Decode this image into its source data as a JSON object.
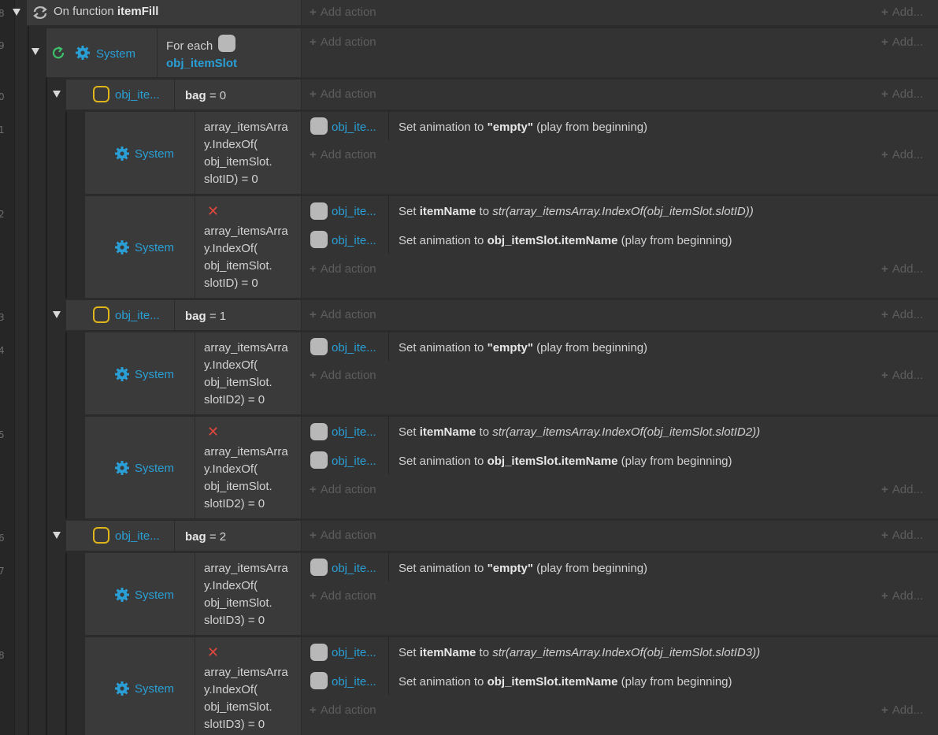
{
  "line_numbers": [
    "8",
    "9",
    "0",
    "1",
    "2",
    "3",
    "4",
    "5",
    "6",
    "7",
    "8"
  ],
  "root_event": {
    "prefix": "On function ",
    "name": "itemFill"
  },
  "add_action_label": "Add action",
  "add_right_label": "Add...",
  "for_each": {
    "system_label": "System",
    "text": "For each",
    "object": "obj_itemSlot"
  },
  "object_short": "obj_ite...",
  "system_label": "System",
  "bag_groups": [
    {
      "cond_var": "bag",
      "cond_rest": " = 0",
      "sub1": {
        "cond": "array_itemsArra\ny.IndexOf(\nobj_itemSlot.\nslotID) = 0",
        "action": {
          "pre": "Set animation to ",
          "val": "\"empty\"",
          "post": " (play from beginning)"
        }
      },
      "sub2": {
        "cond": "array_itemsArra\ny.IndexOf(\nobj_itemSlot.\nslotID) = 0",
        "a1": {
          "pre": "Set ",
          "var": "itemName",
          "mid": " to ",
          "expr": "str(array_itemsArray.IndexOf(obj_itemSlot.slotID))"
        },
        "a2": {
          "pre": "Set animation to ",
          "val": "obj_itemSlot.itemName",
          "post": " (play from beginning)"
        }
      }
    },
    {
      "cond_var": "bag",
      "cond_rest": " = 1",
      "sub1": {
        "cond": "array_itemsArra\ny.IndexOf(\nobj_itemSlot.\nslotID2) = 0",
        "action": {
          "pre": "Set animation to ",
          "val": "\"empty\"",
          "post": " (play from beginning)"
        }
      },
      "sub2": {
        "cond": "array_itemsArra\ny.IndexOf(\nobj_itemSlot.\nslotID2) = 0",
        "a1": {
          "pre": "Set ",
          "var": "itemName",
          "mid": " to ",
          "expr": "str(array_itemsArray.IndexOf(obj_itemSlot.slotID2))"
        },
        "a2": {
          "pre": "Set animation to ",
          "val": "obj_itemSlot.itemName",
          "post": " (play from beginning)"
        }
      }
    },
    {
      "cond_var": "bag",
      "cond_rest": " = 2",
      "sub1": {
        "cond": "array_itemsArra\ny.IndexOf(\nobj_itemSlot.\nslotID3) = 0",
        "action": {
          "pre": "Set animation to ",
          "val": "\"empty\"",
          "post": " (play from beginning)"
        }
      },
      "sub2": {
        "cond": "array_itemsArra\ny.IndexOf(\nobj_itemSlot.\nslotID3) = 0",
        "a1": {
          "pre": "Set ",
          "var": "itemName",
          "mid": " to ",
          "expr": "str(array_itemsArray.IndexOf(obj_itemSlot.slotID3))"
        },
        "a2": {
          "pre": "Set animation to ",
          "val": "obj_itemSlot.itemName",
          "post": " (play from beginning)"
        }
      }
    }
  ],
  "colors": {
    "accent": "#2a9fd6",
    "invert": "#e0463e",
    "loop": "#3cc06a",
    "object_outline": "#e0b51a"
  },
  "icons": [
    "loop-icon",
    "gear-icon",
    "invert-x-icon",
    "expand-triangle-icon"
  ]
}
